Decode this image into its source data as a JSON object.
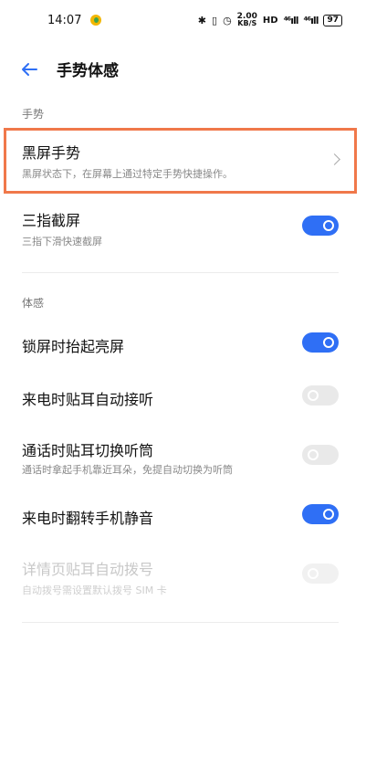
{
  "status_bar": {
    "time": "14:07",
    "speed_value": "2.00",
    "speed_unit": "KB/S",
    "hd_label": "HD",
    "signal1": "⁴⁶ıll",
    "signal2": "⁴⁶ıll",
    "battery": "97"
  },
  "header": {
    "title": "手势体感"
  },
  "sections": {
    "gestures_label": "手势",
    "motion_label": "体感"
  },
  "items": [
    {
      "title": "黑屏手势",
      "subtitle": "黑屏状态下，在屏幕上通过特定手势快捷操作。",
      "control": "chevron"
    },
    {
      "title": "三指截屏",
      "subtitle": "三指下滑快速截屏",
      "control": "toggle",
      "state": "on"
    },
    {
      "title": "锁屏时抬起亮屏",
      "control": "toggle",
      "state": "on"
    },
    {
      "title": "来电时贴耳自动接听",
      "control": "toggle",
      "state": "off"
    },
    {
      "title": "通话时贴耳切换听筒",
      "subtitle": "通话时拿起手机靠近耳朵，免提自动切换为听筒",
      "control": "toggle",
      "state": "off"
    },
    {
      "title": "来电时翻转手机静音",
      "control": "toggle",
      "state": "on"
    },
    {
      "title": "详情页贴耳自动拨号",
      "subtitle": "自动拨号需设置默认拨号 SIM 卡",
      "control": "toggle",
      "state": "off",
      "disabled": true
    }
  ],
  "colors": {
    "accent": "#2f6ff5",
    "highlight": "#f0784a"
  }
}
